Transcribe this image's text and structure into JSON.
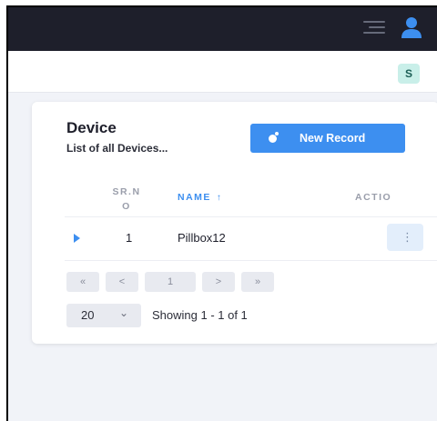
{
  "header": {
    "avatar_initial": "S"
  },
  "card": {
    "title": "Device",
    "subtitle": "List of all Devices...",
    "new_record_label": "New Record"
  },
  "table": {
    "columns": {
      "srno": "SR.N O",
      "name": "NAME",
      "sort_arrow": "↑",
      "action": "ACTIO"
    },
    "rows": [
      {
        "srno": "1",
        "name": "Pillbox12",
        "action": "⋮"
      }
    ]
  },
  "pagination": {
    "first": "«",
    "prev": "<",
    "current_page": "1",
    "next": ">",
    "last": "»",
    "page_size": "20",
    "page_size_chevron": "⌄",
    "showing_text": "Showing 1 - 1 of 1"
  },
  "colors": {
    "topbar": "#1e1f2b",
    "accent": "#3d8ff0",
    "avatar_bg": "#c9efe9",
    "page_bg": "#f1f3f8"
  },
  "icons": [
    "menu-icon",
    "user-icon",
    "expand-arrow-icon",
    "more-vertical-icon",
    "chevron-down-icon",
    "toggle-icon"
  ]
}
